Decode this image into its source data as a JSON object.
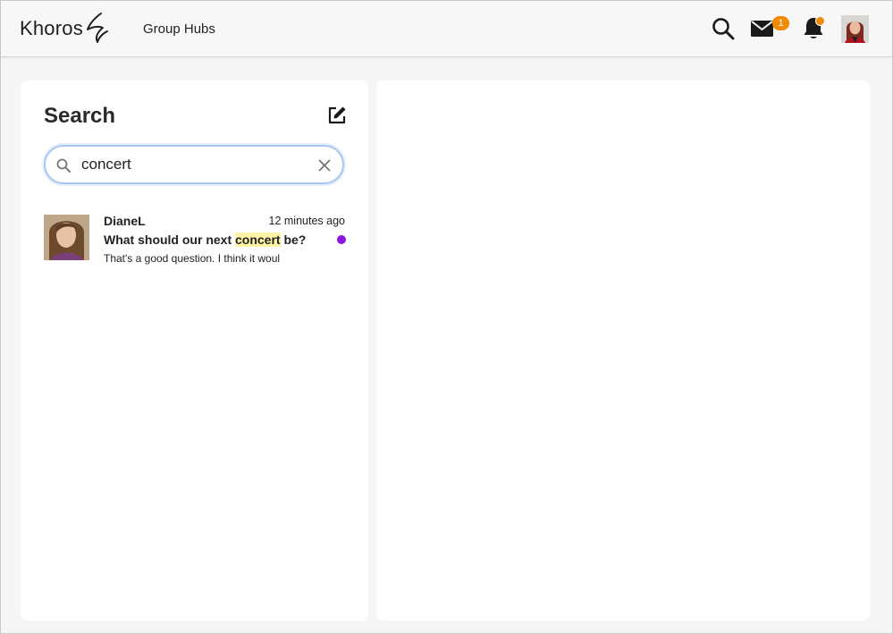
{
  "header": {
    "logo_text": "Khoros",
    "nav_link": "Group Hubs",
    "mail_badge_count": "1",
    "icons": [
      "search-icon",
      "mail-icon",
      "bell-icon",
      "avatar"
    ],
    "accent_color": "#f18a00"
  },
  "search_panel": {
    "title": "Search",
    "query": "concert",
    "results": [
      {
        "author": "DianeL",
        "time": "12 minutes ago",
        "subject_before": "What should our next ",
        "subject_highlight": "concert",
        "subject_after": " be?",
        "snippet": "That's a good question. I think it woul",
        "unread": true,
        "unread_color": "#8a16e0"
      }
    ]
  }
}
